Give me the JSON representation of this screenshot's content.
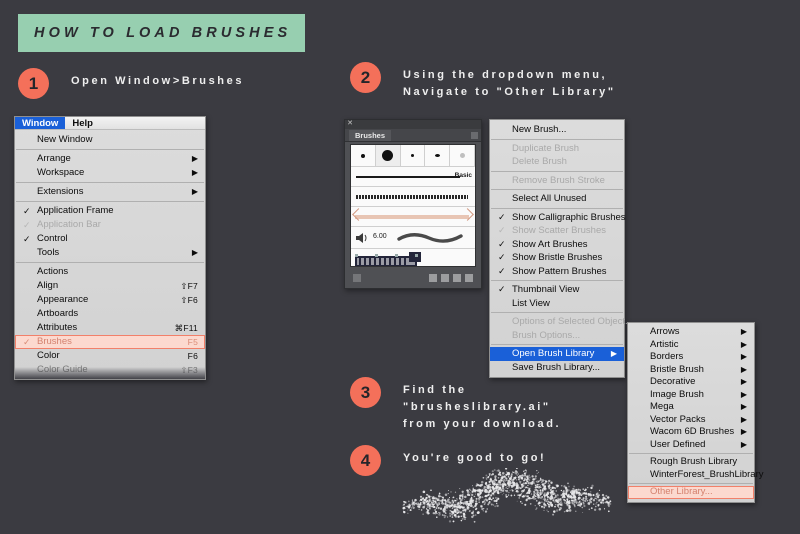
{
  "banner": {
    "title": "HOW TO LOAD BRUSHES"
  },
  "steps": [
    {
      "number": "1",
      "text": "Open Window>Brushes"
    },
    {
      "number": "2",
      "text": "Using the dropdown menu,\nNavigate to \"Other Library\""
    },
    {
      "number": "3",
      "text": "Find the\n\"brusheslibrary.ai\"\nfrom your download."
    },
    {
      "number": "4",
      "text": "You're good to go!"
    }
  ],
  "colors": {
    "background": "#3b3b41",
    "banner_green": "#97cfb0",
    "circle_coral": "#f4705a",
    "highlight_salmon": "#fcd9cf",
    "highlight_salmon_border": "#f2806a",
    "selection_blue": "#1a60d8",
    "menu_gray": "#d6d6d6",
    "panel_dark": "#4f5054"
  },
  "window_menu": {
    "menubar": [
      {
        "label": "Window",
        "active": true
      },
      {
        "label": "Help",
        "active": false
      }
    ],
    "items": [
      {
        "label": "New Window",
        "check": "",
        "shortcut": "",
        "arrow": false,
        "disabled": false,
        "sep_after": true
      },
      {
        "label": "Arrange",
        "check": "",
        "shortcut": "",
        "arrow": true,
        "disabled": false
      },
      {
        "label": "Workspace",
        "check": "",
        "shortcut": "",
        "arrow": true,
        "disabled": false,
        "sep_after": true
      },
      {
        "label": "Extensions",
        "check": "",
        "shortcut": "",
        "arrow": true,
        "disabled": false,
        "sep_after": true
      },
      {
        "label": "Application Frame",
        "check": "✓",
        "shortcut": "",
        "arrow": false,
        "disabled": false
      },
      {
        "label": "Application Bar",
        "check": "✓",
        "shortcut": "",
        "arrow": false,
        "disabled": true
      },
      {
        "label": "Control",
        "check": "✓",
        "shortcut": "",
        "arrow": false,
        "disabled": false
      },
      {
        "label": "Tools",
        "check": "",
        "shortcut": "",
        "arrow": true,
        "disabled": false,
        "sep_after": true
      },
      {
        "label": "Actions",
        "check": "",
        "shortcut": "",
        "arrow": false,
        "disabled": false
      },
      {
        "label": "Align",
        "check": "",
        "shortcut": "⇧F7",
        "arrow": false,
        "disabled": false
      },
      {
        "label": "Appearance",
        "check": "",
        "shortcut": "⇧F6",
        "arrow": false,
        "disabled": false
      },
      {
        "label": "Artboards",
        "check": "",
        "shortcut": "",
        "arrow": false,
        "disabled": false
      },
      {
        "label": "Attributes",
        "check": "",
        "shortcut": "⌘F11",
        "arrow": false,
        "disabled": false
      },
      {
        "label": "Brushes",
        "check": "✓",
        "shortcut": "F5",
        "arrow": false,
        "disabled": false,
        "highlight": "salmon"
      },
      {
        "label": "Color",
        "check": "",
        "shortcut": "F6",
        "arrow": false,
        "disabled": false
      },
      {
        "label": "Color Guide",
        "check": "",
        "shortcut": "⇧F3",
        "arrow": false,
        "disabled": false,
        "faded": true
      }
    ]
  },
  "brush_panel": {
    "tab_label": "Brushes",
    "basic_label": "Basic",
    "size_value": "6.00"
  },
  "brush_dropdown": {
    "items": [
      {
        "label": "New Brush...",
        "check": "",
        "disabled": false,
        "sep_after": true
      },
      {
        "label": "Duplicate Brush",
        "check": "",
        "disabled": true
      },
      {
        "label": "Delete Brush",
        "check": "",
        "disabled": true,
        "sep_after": true
      },
      {
        "label": "Remove Brush Stroke",
        "check": "",
        "disabled": true,
        "sep_after": true
      },
      {
        "label": "Select All Unused",
        "check": "",
        "disabled": false,
        "sep_after": true
      },
      {
        "label": "Show Calligraphic Brushes",
        "check": "✓",
        "disabled": false
      },
      {
        "label": "Show Scatter Brushes",
        "check": "✓",
        "disabled": true
      },
      {
        "label": "Show Art Brushes",
        "check": "✓",
        "disabled": false
      },
      {
        "label": "Show Bristle Brushes",
        "check": "✓",
        "disabled": false
      },
      {
        "label": "Show Pattern Brushes",
        "check": "✓",
        "disabled": false,
        "sep_after": true
      },
      {
        "label": "Thumbnail View",
        "check": "✓",
        "disabled": false
      },
      {
        "label": "List View",
        "check": "",
        "disabled": false,
        "sep_after": true
      },
      {
        "label": "Options of Selected Object...",
        "check": "",
        "disabled": true
      },
      {
        "label": "Brush Options...",
        "check": "",
        "disabled": true,
        "sep_after": true
      },
      {
        "label": "Open Brush Library",
        "check": "",
        "disabled": false,
        "arrow": true,
        "highlight": "blue"
      },
      {
        "label": "Save Brush Library...",
        "check": "",
        "disabled": false
      }
    ]
  },
  "brush_library_submenu": {
    "items": [
      {
        "label": "Arrows",
        "arrow": true
      },
      {
        "label": "Artistic",
        "arrow": true
      },
      {
        "label": "Borders",
        "arrow": true
      },
      {
        "label": "Bristle Brush",
        "arrow": true
      },
      {
        "label": "Decorative",
        "arrow": true
      },
      {
        "label": "Image Brush",
        "arrow": true
      },
      {
        "label": "Mega",
        "arrow": true
      },
      {
        "label": "Vector Packs",
        "arrow": true
      },
      {
        "label": "Wacom 6D Brushes",
        "arrow": true
      },
      {
        "label": "User Defined",
        "arrow": true,
        "sep_after": true
      },
      {
        "label": "Rough Brush Library",
        "arrow": false
      },
      {
        "label": "WinterForest_BrushLibrary",
        "arrow": false,
        "sep_after": true
      },
      {
        "label": "Other Library...",
        "arrow": false,
        "highlight": "salmon"
      }
    ]
  }
}
